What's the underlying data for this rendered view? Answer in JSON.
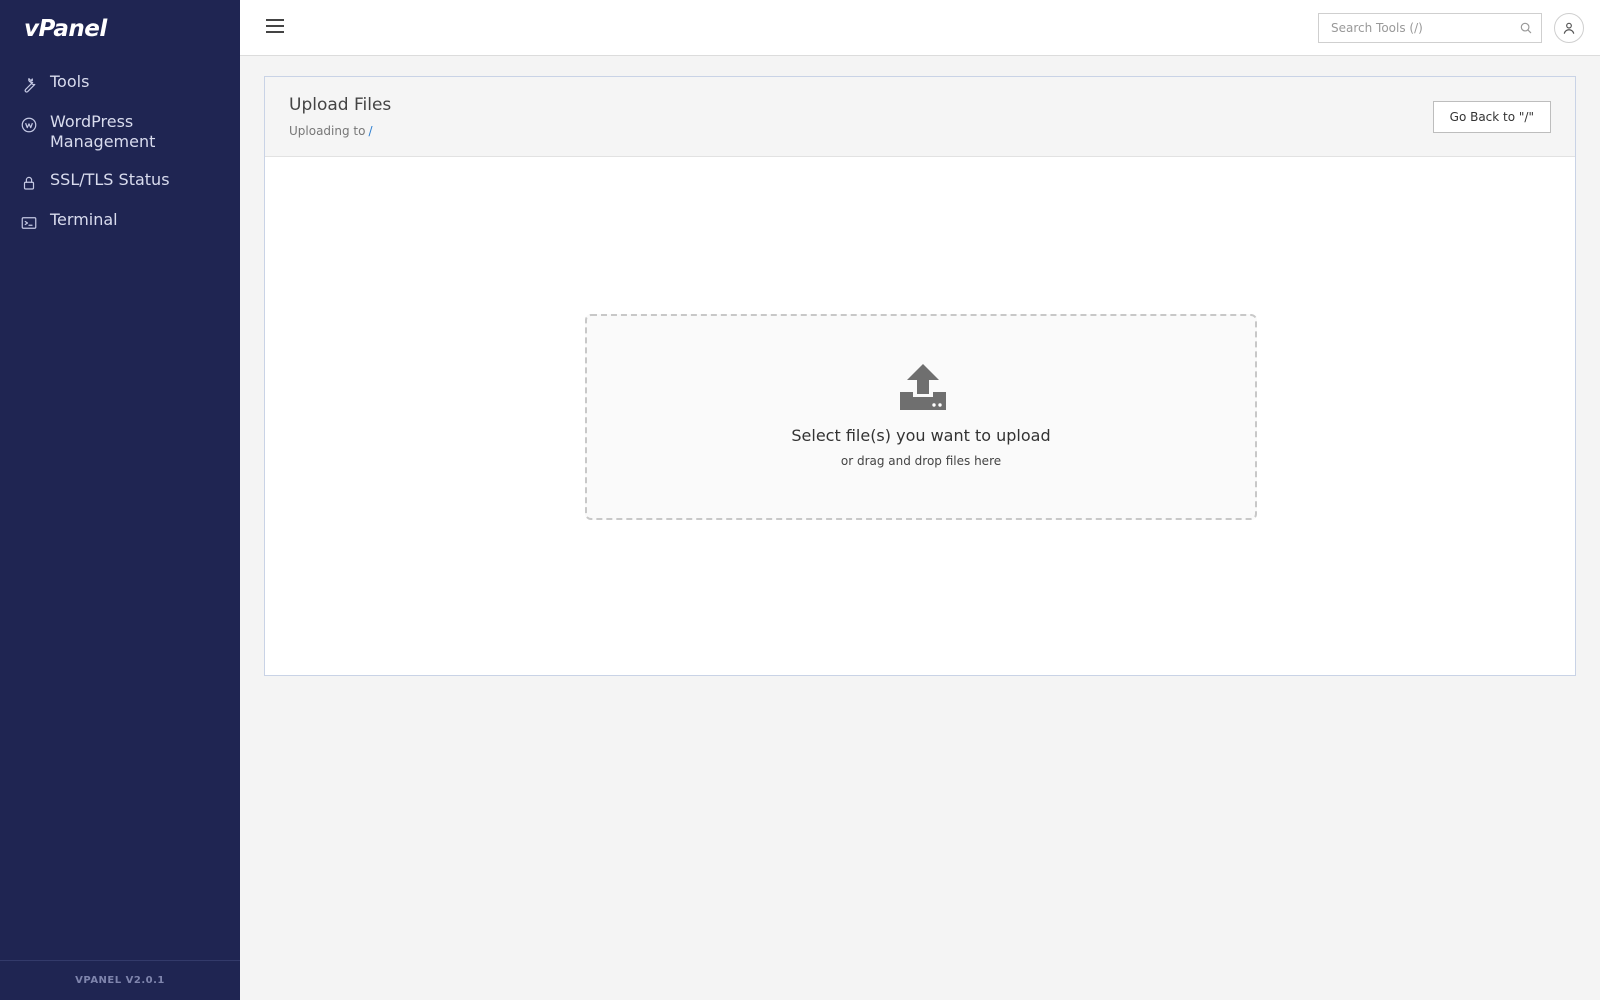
{
  "app": {
    "logo_text": "vPanel",
    "version": "VPANEL V2.0.1"
  },
  "sidebar": {
    "items": [
      {
        "label": "Tools",
        "icon": "wrench-icon"
      },
      {
        "label": "WordPress Management",
        "icon": "wordpress-icon"
      },
      {
        "label": "SSL/TLS Status",
        "icon": "lock-icon"
      },
      {
        "label": "Terminal",
        "icon": "terminal-icon"
      }
    ]
  },
  "topbar": {
    "search_placeholder": "Search Tools (/)",
    "search_value": ""
  },
  "card": {
    "title": "Upload Files",
    "subtitle_prefix": "Uploading to",
    "path": "/",
    "back_button": "Go Back to \"/\""
  },
  "dropzone": {
    "title": "Select file(s) you want to upload",
    "subtitle": "or drag and drop files here"
  },
  "colors": {
    "sidebar_bg": "#1f2552",
    "link": "#2d7fd1",
    "page_bg": "#f4f4f4"
  }
}
